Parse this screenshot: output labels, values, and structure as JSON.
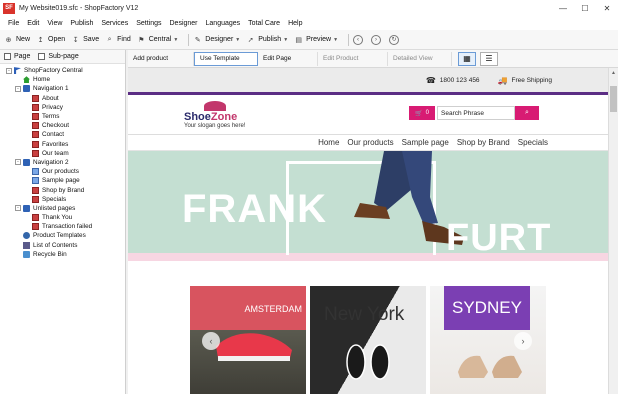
{
  "window": {
    "logo": "SF",
    "title": "My Website019.sfc - ShopFactory V12",
    "controls": [
      "—",
      "☐",
      "✕"
    ]
  },
  "menu": [
    "File",
    "Edit",
    "View",
    "Publish",
    "Services",
    "Settings",
    "Designer",
    "Languages",
    "Total Care",
    "Help"
  ],
  "toolbar": {
    "new": "New",
    "open": "Open",
    "save": "Save",
    "find": "Find",
    "central": "Central",
    "designer": "Designer",
    "publish": "Publish",
    "preview": "Preview"
  },
  "tree": {
    "tabs": [
      "Page",
      "Sub-page"
    ],
    "items": [
      {
        "label": "ShopFactory Central",
        "icon": "flag-icon",
        "level": 0,
        "exp": "-"
      },
      {
        "label": "Home",
        "icon": "home-icon",
        "level": 1,
        "exp": ""
      },
      {
        "label": "Navigation 1",
        "icon": "folder-icon",
        "level": 1,
        "exp": "-"
      },
      {
        "label": "About",
        "icon": "page-icon",
        "level": 2,
        "exp": ""
      },
      {
        "label": "Privacy",
        "icon": "page-icon",
        "level": 2,
        "exp": ""
      },
      {
        "label": "Terms",
        "icon": "page-icon",
        "level": 2,
        "exp": ""
      },
      {
        "label": "Checkout",
        "icon": "page-icon",
        "level": 2,
        "exp": ""
      },
      {
        "label": "Contact",
        "icon": "page-icon",
        "level": 2,
        "exp": ""
      },
      {
        "label": "Favorites",
        "icon": "page-icon",
        "level": 2,
        "exp": ""
      },
      {
        "label": "Our team",
        "icon": "page-icon",
        "level": 2,
        "exp": ""
      },
      {
        "label": "Navigation 2",
        "icon": "folder-icon",
        "level": 1,
        "exp": "-"
      },
      {
        "label": "Our products",
        "icon": "page-blue-icon",
        "level": 2,
        "exp": ""
      },
      {
        "label": "Sample page",
        "icon": "page-blue-icon",
        "level": 2,
        "exp": ""
      },
      {
        "label": "Shop by Brand",
        "icon": "page-icon",
        "level": 2,
        "exp": ""
      },
      {
        "label": "Specials",
        "icon": "page-icon",
        "level": 2,
        "exp": ""
      },
      {
        "label": "Unlisted pages",
        "icon": "folder-icon",
        "level": 1,
        "exp": "-"
      },
      {
        "label": "Thank You",
        "icon": "page-icon",
        "level": 2,
        "exp": ""
      },
      {
        "label": "Transaction failed",
        "icon": "page-icon",
        "level": 2,
        "exp": ""
      },
      {
        "label": "Product Templates",
        "icon": "gear-icon",
        "level": 1,
        "exp": ""
      },
      {
        "label": "List of Contents",
        "icon": "list-icon",
        "level": 1,
        "exp": ""
      },
      {
        "label": "Recycle Bin",
        "icon": "bin-icon",
        "level": 1,
        "exp": ""
      }
    ]
  },
  "editbar": {
    "add_product": "Add product",
    "use_template": "Use Template",
    "edit_page": "Edit Page",
    "edit_product": "Edit Product",
    "detailed_view": "Detailed View"
  },
  "site": {
    "phone": "1800 123 456",
    "shipping": "Free Shipping",
    "logo_shoe": "Shoe",
    "logo_zone": "Zone",
    "slogan": "Your slogan goes here!",
    "cart_count": "0",
    "search_placeholder": "Search Phrase",
    "nav": [
      "Home",
      "Our products",
      "Sample page",
      "Shop by Brand",
      "Specials"
    ],
    "hero_left": "FRANK",
    "hero_right": "FURT",
    "cities": [
      "AMSTERDAM",
      "New York",
      "SYDNEY"
    ]
  },
  "colors": {
    "brand_pink": "#d81b73",
    "brand_purple": "#5b2d84",
    "hero_bg": "#c4dfd2"
  }
}
